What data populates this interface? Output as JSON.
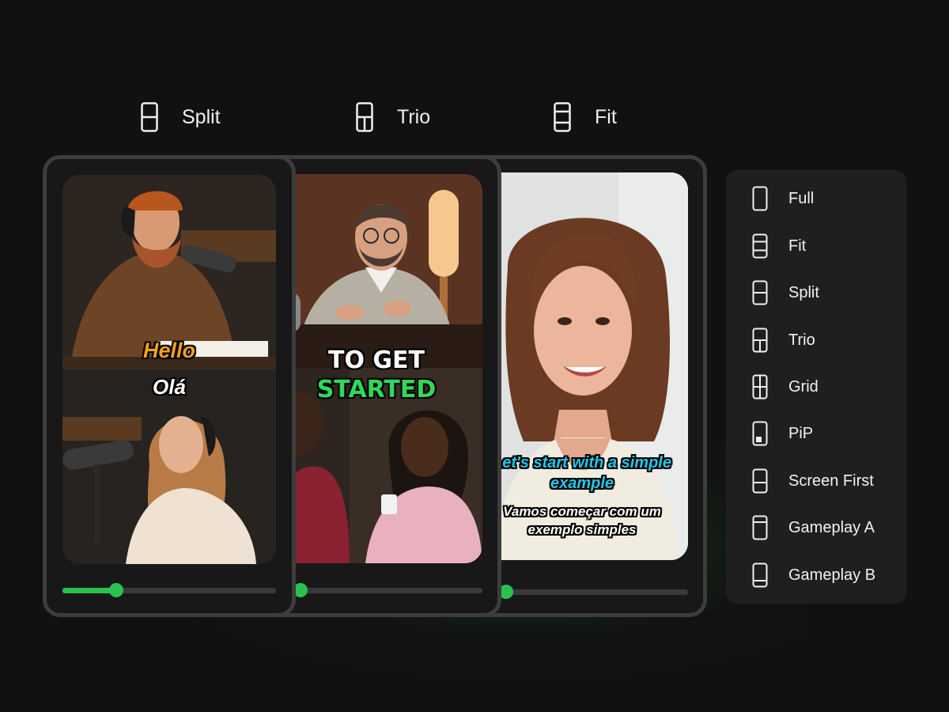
{
  "layout_labels": [
    {
      "label": "Split",
      "icon": "split-layout-icon"
    },
    {
      "label": "Trio",
      "icon": "trio-layout-icon"
    },
    {
      "label": "Fit",
      "icon": "fit-layout-icon"
    }
  ],
  "cards": {
    "split": {
      "caption_primary": "Hello",
      "caption_secondary": "Olá",
      "progress": 0.25
    },
    "trio": {
      "caption_line1": "TO GET",
      "caption_line2": "STARTED",
      "progress": 0.14
    },
    "fit": {
      "caption_line1": "Let's start with a simple",
      "caption_line2": "example",
      "translation_line1": "Vamos começar com um",
      "translation_line2": "exemplo simples",
      "progress": 0.14
    }
  },
  "menu": {
    "items": [
      {
        "label": "Full",
        "icon": "full-layout-icon"
      },
      {
        "label": "Fit",
        "icon": "fit-layout-icon"
      },
      {
        "label": "Split",
        "icon": "split-layout-icon"
      },
      {
        "label": "Trio",
        "icon": "trio-layout-icon"
      },
      {
        "label": "Grid",
        "icon": "grid-layout-icon"
      },
      {
        "label": "PiP",
        "icon": "pip-layout-icon"
      },
      {
        "label": "Screen First",
        "icon": "screen-first-layout-icon"
      },
      {
        "label": "Gameplay A",
        "icon": "gameplay-a-layout-icon"
      },
      {
        "label": "Gameplay B",
        "icon": "gameplay-b-layout-icon"
      }
    ]
  },
  "colors": {
    "accent": "#28c24c",
    "background": "#111111",
    "card_border": "#3d3d3d",
    "caption_orange": "#f3a21a",
    "caption_green": "#30d85a",
    "caption_cyan": "#22c8e8"
  }
}
